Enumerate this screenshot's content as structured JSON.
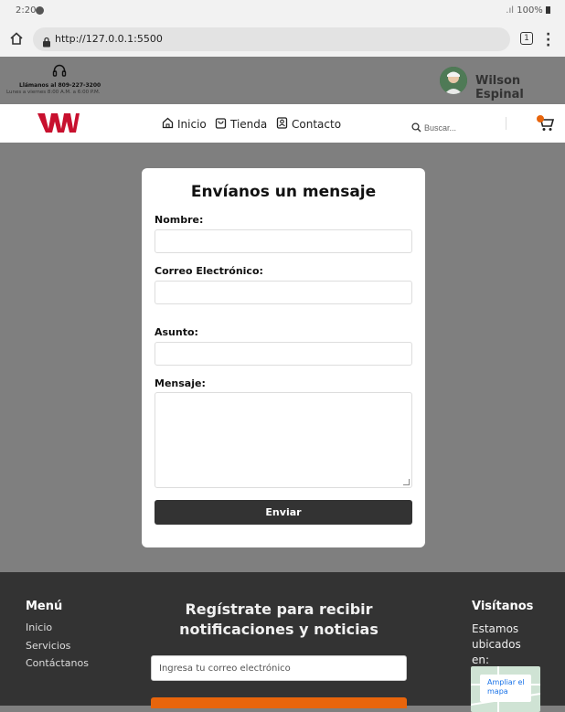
{
  "statusbar": {
    "time": "2:20",
    "battery": "100%"
  },
  "browser": {
    "url": "http://127.0.0.1:5500",
    "tab_count": "1"
  },
  "infobar": {
    "call_text": "Llámanos al 809-227-3200",
    "hours_text": "Lunes a viernes 8:00 A.M. a 6:00 P.M.",
    "user_name": "Wilson Espinal"
  },
  "nav": {
    "items": [
      {
        "label": "Inicio",
        "icon": "home-icon"
      },
      {
        "label": "Tienda",
        "icon": "bag-icon"
      },
      {
        "label": "Contacto",
        "icon": "contact-card-icon"
      }
    ],
    "search_placeholder": "Buscar..."
  },
  "form": {
    "title": "Envíanos un mensaje",
    "fields": {
      "name_label": "Nombre:",
      "email_label": "Correo Electrónico:",
      "subject_label": "Asunto:",
      "message_label": "Mensaje:"
    },
    "submit_label": "Enviar"
  },
  "footer": {
    "menu_title": "Menú",
    "menu_items": [
      "Inicio",
      "Servicios",
      "Contáctanos"
    ],
    "newsletter_title": "Regístrate para recibir notificaciones y noticias",
    "newsletter_placeholder": "Ingresa tu correo electrónico",
    "visit_title": "Visítanos",
    "visit_text": "Estamos ubicados en:",
    "map_link": "Ampliar el mapa"
  },
  "colors": {
    "accent": "#e8650c",
    "brand_red": "#c8102e",
    "dark": "#333333",
    "page_bg": "#7f7f7f"
  }
}
